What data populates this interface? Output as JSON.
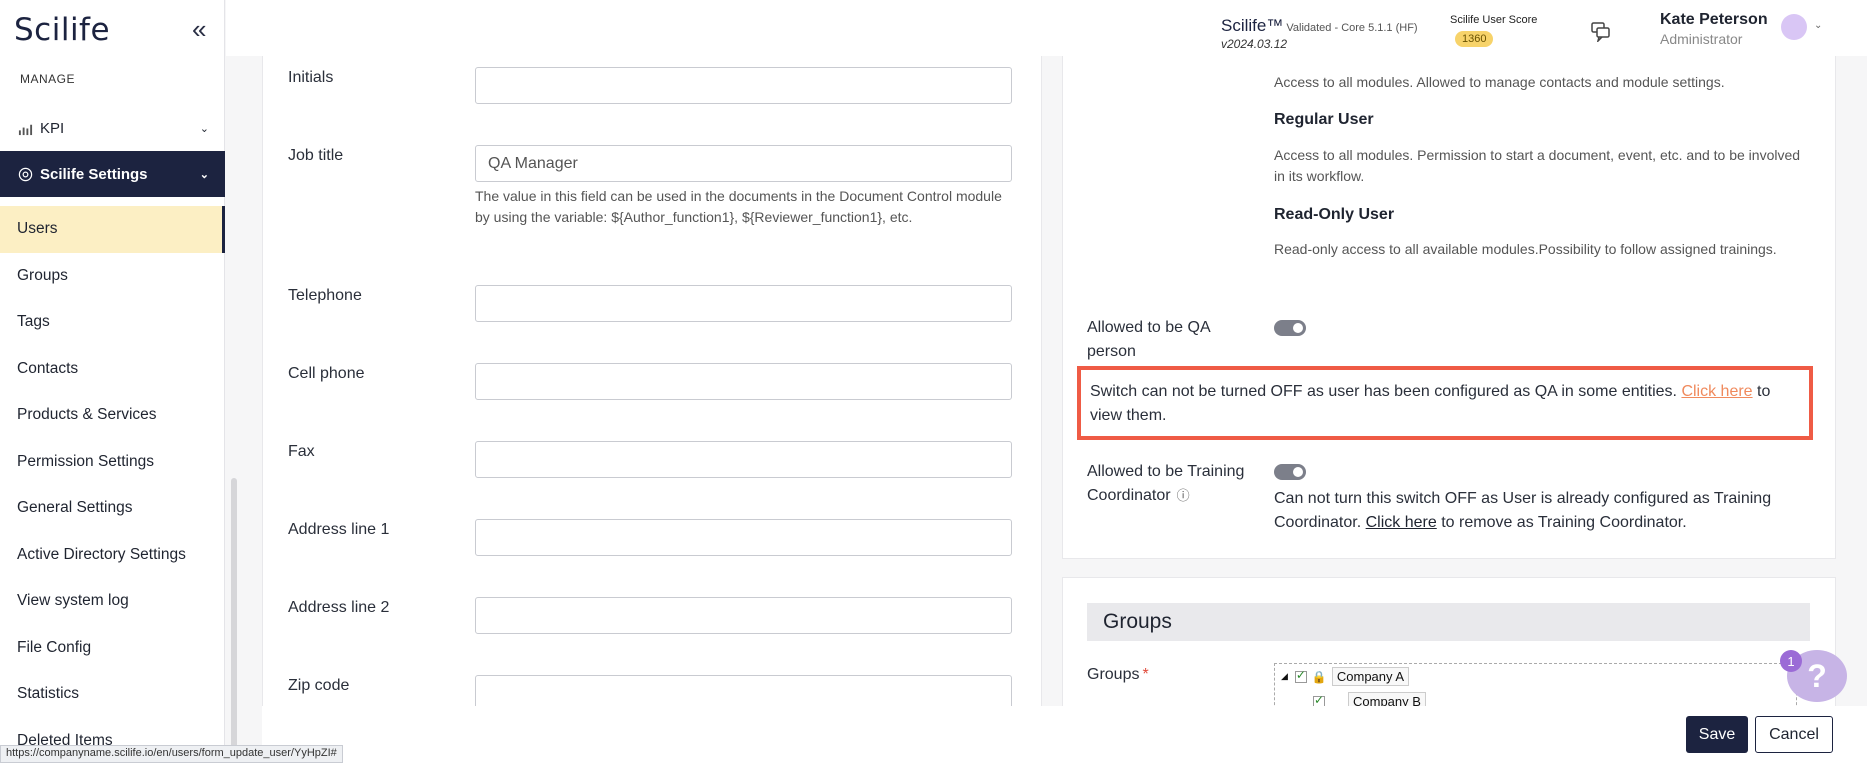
{
  "sidebar": {
    "logo": "Scilife",
    "section": "MANAGE",
    "kpi_label": "KPI",
    "settings_label": "Scilife Settings",
    "items": [
      {
        "label": "Users"
      },
      {
        "label": "Groups"
      },
      {
        "label": "Tags"
      },
      {
        "label": "Contacts"
      },
      {
        "label": "Products & Services"
      },
      {
        "label": "Permission Settings"
      },
      {
        "label": "General Settings"
      },
      {
        "label": "Active Directory Settings"
      },
      {
        "label": "View system log"
      },
      {
        "label": "File Config"
      },
      {
        "label": "Statistics"
      },
      {
        "label": "Deleted Items"
      }
    ]
  },
  "header": {
    "product": "Scilife™",
    "validated": "Validated - Core 5.1.1 (HF)",
    "version": "v2024.03.12",
    "score_label": "Scilife User Score",
    "score_value": "1360",
    "user_name": "Kate Peterson",
    "user_role": "Administrator"
  },
  "form": {
    "initials_label": "Initials",
    "initials_value": "",
    "job_title_label": "Job title",
    "job_title_value": "QA Manager",
    "job_title_help": "The value in this field can be used in the documents in the Document Control module by using the variable: ${Author_function1}, ${Reviewer_function1}, etc.",
    "telephone_label": "Telephone",
    "cell_phone_label": "Cell phone",
    "fax_label": "Fax",
    "address1_label": "Address line 1",
    "address2_label": "Address line 2",
    "zip_label": "Zip code"
  },
  "roles": {
    "admin_desc": "Access to all modules. Allowed to manage contacts and module settings.",
    "regular_title": "Regular User",
    "regular_desc": "Access to all modules. Permission to start a document, event, etc. and to be involved in its workflow.",
    "readonly_title": "Read-Only User",
    "readonly_desc": "Read-only access to all available modules.Possibility to follow assigned trainings."
  },
  "qa": {
    "label": "Allowed to be QA person",
    "warning_text": "Switch can not be turned OFF as user has been configured as QA in some entities.",
    "warning_link": "Click here",
    "warning_tail": "to view them."
  },
  "training": {
    "label": "Allowed to be Training Coordinator",
    "note_text": "Can not turn this switch OFF as User is already configured as Training Coordinator.",
    "note_link": "Click here",
    "note_tail": "to remove as Training Coordinator."
  },
  "groups": {
    "title": "Groups",
    "label": "Groups",
    "required": "*",
    "tree": [
      "Company A",
      "Company B"
    ]
  },
  "help_badge": "1",
  "help_symbol": "?",
  "buttons": {
    "save": "Save",
    "cancel": "Cancel"
  },
  "status_url": "https://companyname.scilife.io/en/users/form_update_user/YyHpZI#",
  "colors": {
    "navy": "#1c2340",
    "highlight": "#fcefc4",
    "warning": "#ef5b45",
    "link": "#f08a5d",
    "badge": "#f7d36a"
  }
}
